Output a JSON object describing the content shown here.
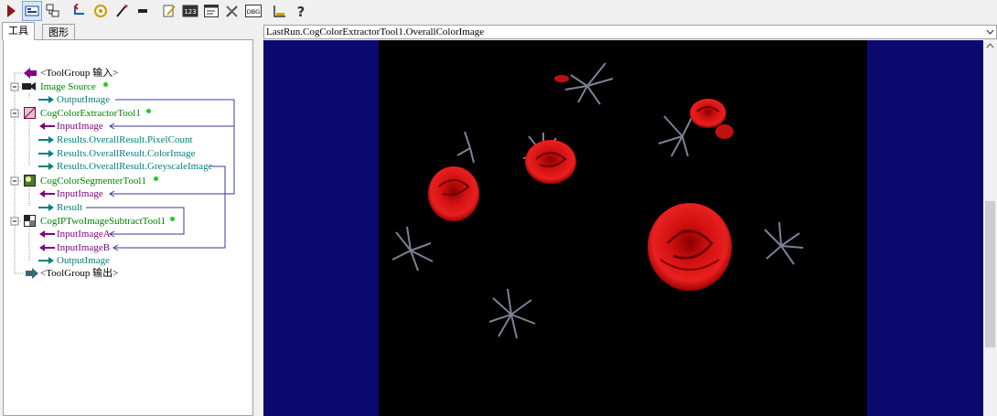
{
  "toolbar": {
    "buttons": [
      {
        "name": "run-icon",
        "active": false
      },
      {
        "name": "toggle-view-icon",
        "active": true
      },
      {
        "name": "tree-view-icon",
        "active": false
      },
      {
        "name": "undo-icon",
        "active": false
      },
      {
        "name": "refresh-icon",
        "active": false
      },
      {
        "name": "wand-icon",
        "active": false
      },
      {
        "name": "key-icon",
        "active": false
      },
      {
        "name": "edit-icon",
        "active": false
      },
      {
        "name": "counter-icon",
        "active": false
      },
      {
        "name": "terminal-icon",
        "active": false
      },
      {
        "name": "tools-icon",
        "active": false
      },
      {
        "name": "dbg-icon",
        "active": false
      },
      {
        "name": "ruler-icon",
        "active": false
      },
      {
        "name": "help-icon",
        "active": false
      }
    ],
    "dbg_label": "DBG",
    "counter_label": "123",
    "help_label": "?"
  },
  "left_panel": {
    "tabs": [
      {
        "label": "工具",
        "selected": true
      },
      {
        "label": "图形",
        "selected": false
      }
    ],
    "tree": [
      {
        "label": "<ToolGroup 输入>",
        "kind": "group-in",
        "color": "#000000"
      },
      {
        "label": "Image Source",
        "kind": "tool",
        "color": "#008000",
        "status": "ok"
      },
      {
        "label": "OutputImage",
        "kind": "output",
        "color": "#008080"
      },
      {
        "label": "CogColorExtractorTool1",
        "kind": "tool",
        "color": "#008000",
        "status": "ok"
      },
      {
        "label": "InputImage",
        "kind": "input",
        "color": "#800080"
      },
      {
        "label": "Results.OverallResult.PixelCount",
        "kind": "output",
        "color": "#008080"
      },
      {
        "label": "Results.OverallResult.ColorImage",
        "kind": "output",
        "color": "#008080"
      },
      {
        "label": "Results.OverallResult.GreyscaleImage",
        "kind": "output",
        "color": "#008080"
      },
      {
        "label": "CogColorSegmenterTool1",
        "kind": "tool",
        "color": "#008000",
        "status": "ok"
      },
      {
        "label": "InputImage",
        "kind": "input",
        "color": "#800080"
      },
      {
        "label": "Result",
        "kind": "output",
        "color": "#008080"
      },
      {
        "label": "CogIPTwoImageSubtractTool1",
        "kind": "tool",
        "color": "#008000",
        "status": "ok"
      },
      {
        "label": "InputImageA",
        "kind": "input",
        "color": "#800080"
      },
      {
        "label": "InputImageB",
        "kind": "input",
        "color": "#800080"
      },
      {
        "label": "OutputImage",
        "kind": "output",
        "color": "#008080"
      },
      {
        "label": "<ToolGroup 输出>",
        "kind": "group-out",
        "color": "#000000"
      }
    ]
  },
  "display": {
    "selected_image": "LastRun.CogColorExtractorTool1.OverallColorImage",
    "background_color": "#0a0a6e",
    "image_background": "#000000"
  },
  "colors": {
    "status_ok": "#22cc22",
    "link_line": "#3a3aa0",
    "input_arrow": "#800080",
    "output_arrow": "#008080"
  }
}
